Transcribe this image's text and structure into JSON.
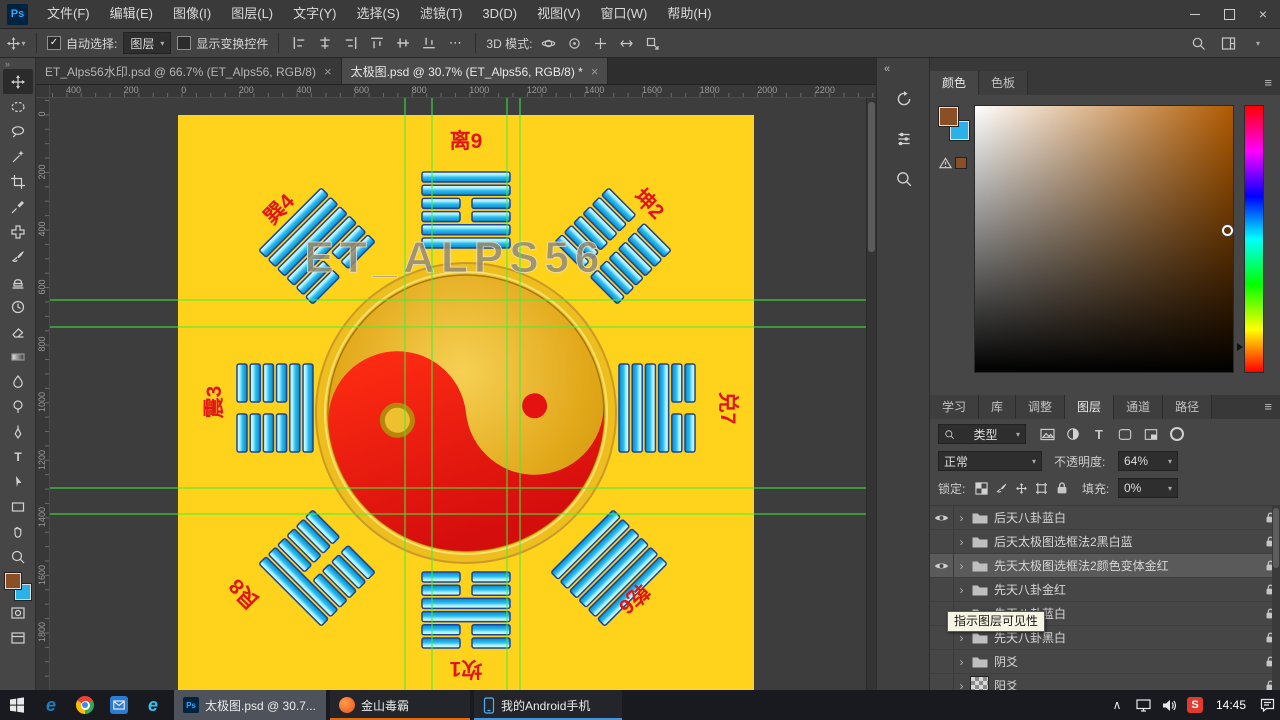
{
  "app": {
    "logo_text": "Ps"
  },
  "menubar": {
    "items": [
      "文件(F)",
      "编辑(E)",
      "图像(I)",
      "图层(L)",
      "文字(Y)",
      "选择(S)",
      "滤镜(T)",
      "3D(D)",
      "视图(V)",
      "窗口(W)",
      "帮助(H)"
    ]
  },
  "options_bar": {
    "auto_select_label": "自动选择:",
    "auto_select_value": "图层",
    "show_transform_label": "显示变换控件",
    "more_label": "⋯",
    "mode_label": "3D 模式:"
  },
  "document_tabs": [
    {
      "title": "ET_Alps56水印.psd @ 66.7% (ET_Alps56, RGB/8)",
      "close": "×",
      "active": false
    },
    {
      "title": "太极图.psd @ 30.7% (ET_Alps56, RGB/8) *",
      "close": "×",
      "active": true
    }
  ],
  "rulers": {
    "top_labels": [
      "400",
      "200",
      "0",
      "200",
      "400",
      "600",
      "800",
      "1000",
      "1200",
      "1400",
      "1600",
      "1800",
      "2000",
      "2200"
    ],
    "left_labels": [
      "0",
      "200",
      "400",
      "600",
      "800",
      "1000",
      "1200",
      "1400",
      "1600",
      "1800"
    ]
  },
  "canvas": {
    "watermark": "ET_ALPS56",
    "trigrams": [
      {
        "label": "离9",
        "lines": [
          1,
          1,
          0,
          0,
          1,
          1
        ]
      },
      {
        "label": "坤2",
        "lines": [
          0,
          0,
          0,
          0,
          0,
          0
        ]
      },
      {
        "label": "兑7",
        "lines": [
          0,
          0,
          1,
          1,
          1,
          1
        ]
      },
      {
        "label": "乾6",
        "lines": [
          1,
          1,
          1,
          1,
          1,
          1
        ]
      },
      {
        "label": "坎1",
        "lines": [
          0,
          0,
          1,
          1,
          0,
          0
        ]
      },
      {
        "label": "艮8",
        "lines": [
          1,
          1,
          0,
          0,
          0,
          0
        ]
      },
      {
        "label": "震3",
        "lines": [
          0,
          0,
          0,
          0,
          1,
          1
        ]
      },
      {
        "label": "巽4",
        "lines": [
          1,
          1,
          1,
          1,
          0,
          0
        ]
      }
    ]
  },
  "color_panel": {
    "tabs": [
      "颜色",
      "色板"
    ]
  },
  "dock_tabs": [
    "学习",
    "库",
    "调整",
    "图层",
    "通道",
    "路径"
  ],
  "layers_panel": {
    "filter_value": "类型",
    "blend_mode": "正常",
    "opacity_label": "不透明度:",
    "opacity_value": "64%",
    "lock_label": "锁定:",
    "fill_label": "填充:",
    "fill_value": "0%",
    "tooltip": "指示图层可见性",
    "layers": [
      {
        "name": "后天八卦蓝白",
        "eye": true,
        "selected": false,
        "kind": "group"
      },
      {
        "name": "后天太极图选框法2黑白蓝",
        "eye": false,
        "selected": false,
        "kind": "group"
      },
      {
        "name": "先天太极图选框法2颜色变体金红",
        "eye": true,
        "selected": true,
        "kind": "group"
      },
      {
        "name": "先天八卦金红",
        "eye": false,
        "selected": false,
        "kind": "group"
      },
      {
        "name": "先天八卦蓝白",
        "eye": false,
        "selected": false,
        "kind": "group"
      },
      {
        "name": "先天八卦黑白",
        "eye": false,
        "selected": false,
        "kind": "group"
      },
      {
        "name": "阴爻",
        "eye": false,
        "selected": false,
        "kind": "group"
      },
      {
        "name": "阳爻",
        "eye": false,
        "selected": false,
        "kind": "pattern"
      }
    ]
  },
  "taskbar": {
    "buttons": [
      {
        "label": "太极图.psd @ 30.7..."
      },
      {
        "label": "金山毒霸"
      },
      {
        "label": "我的Android手机"
      }
    ],
    "time": "14:45"
  }
}
